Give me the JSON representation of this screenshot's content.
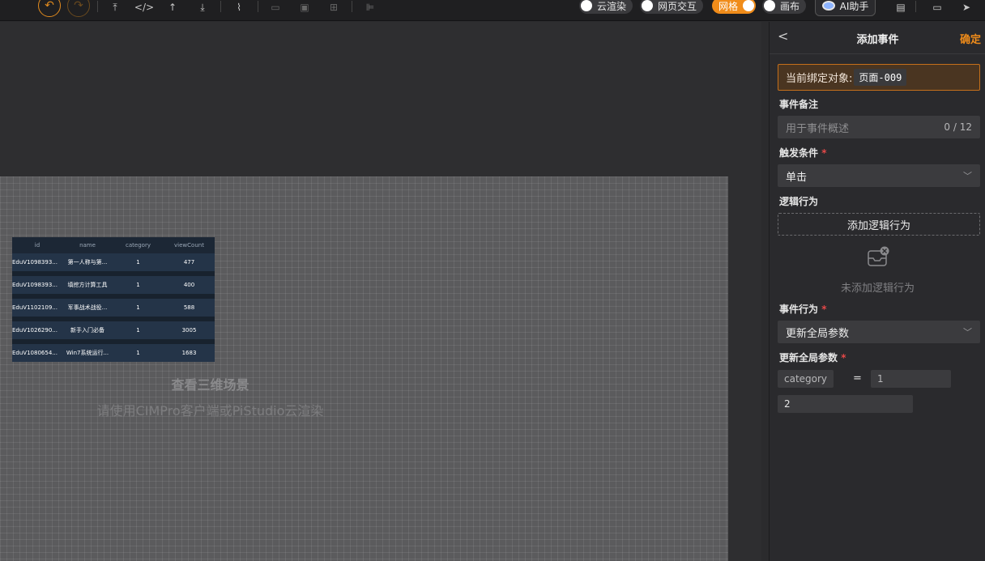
{
  "toolbar": {
    "icons": [
      "undo-icon",
      "redo-icon",
      "upload-icon",
      "code-icon",
      "publish-icon",
      "download-icon",
      "clean-icon",
      "delete-icon",
      "screenshot-icon",
      "transform-icon",
      "align-icon"
    ],
    "toggles": [
      {
        "label": "云渲染",
        "on": false
      },
      {
        "label": "网页交互",
        "on": false
      },
      {
        "label": "网格",
        "on": true
      },
      {
        "label": "画布",
        "on": false
      }
    ],
    "ai_label": "AI助手",
    "accent": "#f08c1a"
  },
  "scene": {
    "line1": "查看三维场景",
    "line2": "请使用CIMPro客户端或PiStudio云渲染"
  },
  "table": {
    "headers": [
      "id",
      "name",
      "category",
      "viewCount"
    ],
    "rows": [
      [
        "EduV1098393...",
        "第一人称与第...",
        "1",
        "477"
      ],
      [
        "EduV1098393...",
        "填挖方计算工具",
        "1",
        "400"
      ],
      [
        "EduV1102109...",
        "军事战术战役...",
        "1",
        "588"
      ],
      [
        "EduV1026290...",
        "新手入门必备",
        "1",
        "3005"
      ],
      [
        "EduV1080654...",
        "Win7系统运行...",
        "1",
        "1683"
      ]
    ]
  },
  "panel": {
    "back": "<",
    "title": "添加事件",
    "confirm": "确定",
    "bound_label": "当前绑定对象:",
    "bound_value": "页面-009",
    "note_label": "事件备注",
    "note_placeholder": "用于事件概述",
    "note_count": "0 / 12",
    "trigger_label": "触发条件",
    "trigger_value": "单击",
    "logic_label": "逻辑行为",
    "logic_add": "添加逻辑行为",
    "logic_empty": "未添加逻辑行为",
    "action_label": "事件行为",
    "action_value": "更新全局参数",
    "update_label": "更新全局参数",
    "param_key": "category",
    "param_eq": "=",
    "param_value_placeholder": "1",
    "param_value2": "2",
    "required_mark": "*"
  }
}
